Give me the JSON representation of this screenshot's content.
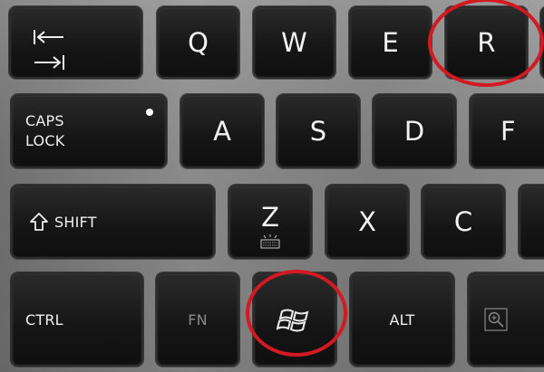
{
  "keys": {
    "tab": {
      "arrow_top": "|←",
      "arrow_bottom": "→|"
    },
    "q": "Q",
    "w": "W",
    "e": "E",
    "r": "R",
    "caps_line1": "CAPS",
    "caps_line2": "LOCK",
    "a": "A",
    "s": "S",
    "d": "D",
    "f": "F",
    "shift": "SHIFT",
    "z": "Z",
    "x": "X",
    "c": "C",
    "ctrl": "CTRL",
    "fn": "FN",
    "alt": "ALT"
  },
  "annotations": {
    "highlight_color": "#d31a22",
    "circled_keys": [
      "R",
      "Windows"
    ]
  },
  "icons": {
    "tab": "tab-arrows-icon",
    "shift": "shift-arrow-icon",
    "windows": "windows-logo-icon",
    "z_backlight": "keyboard-backlight-icon",
    "magnifier": "zoom-magnifier-icon"
  }
}
